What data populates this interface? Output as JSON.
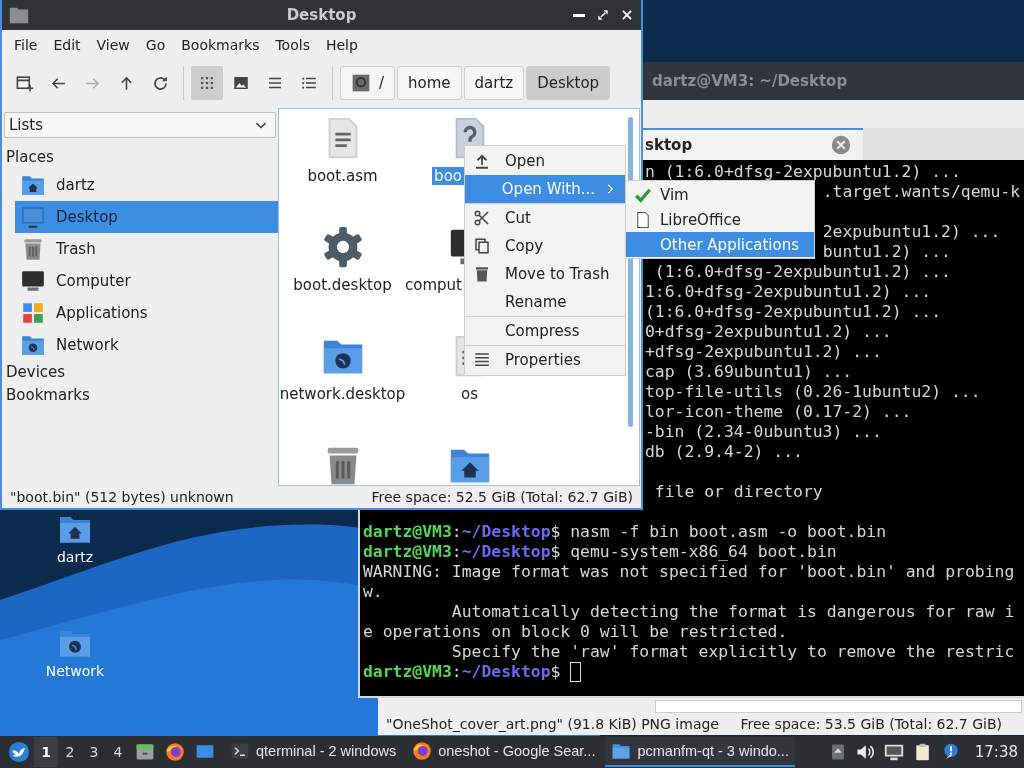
{
  "desktop_icons": [
    {
      "label": "dartz",
      "kind": "home"
    },
    {
      "label": "Network",
      "kind": "network"
    }
  ],
  "background_window": {
    "status_left": "\"OneShot_cover_art.png\" (91.8 KiB) PNG image",
    "status_right": "Free space: 53.5 GiB (Total: 62.7 GiB)"
  },
  "terminal": {
    "title": "dartz@VM3: ~/Desktop",
    "tab": {
      "label": "sktop",
      "selected": true
    },
    "upper_lines": [
      "n (1:6.0+dfsg-2expubuntu1.2) ...",
      ".target.wants/qemu-k",
      "2expubuntu1.2) ...",
      "buntu1.2) ...",
      "(1:6.0+dfsg-2expubuntu1.2) ...",
      "1:6.0+dfsg-2expubuntu1.2) ...",
      "(1:6.0+dfsg-2expubuntu1.2) ...",
      "0+dfsg-2expubuntu1.2) ...",
      "+dfsg-2expubuntu1.2) ...",
      "cap (3.69ubuntu1) ...",
      "top-file-utils (0.26-1ubuntu2) ...",
      "lor-icon-theme (0.17-2) ...",
      "-bin (2.34-0ubuntu3) ...",
      "db (2.9.4-2) ...",
      "file or directory"
    ],
    "lines": [
      {
        "kind": "prompt",
        "user": "dartz@VM3",
        "sep": ":",
        "path": "~/Desktop",
        "command": "$ nasm -f bin boot.asm -o boot.bin",
        "cursor": false
      },
      {
        "kind": "prompt",
        "user": "dartz@VM3",
        "sep": ":",
        "path": "~/Desktop",
        "command": "$ qemu-system-x86_64 boot.bin",
        "cursor": false
      },
      {
        "kind": "output",
        "text": "WARNING: Image format was not specified for 'boot.bin' and probing"
      },
      {
        "kind": "output",
        "text": "w."
      },
      {
        "kind": "output",
        "text": "         Automatically detecting the format is dangerous for raw i"
      },
      {
        "kind": "output",
        "text": "e operations on block 0 will be restricted."
      },
      {
        "kind": "output",
        "text": "         Specify the 'raw' format explicitly to remove the restric"
      },
      {
        "kind": "prompt",
        "user": "dartz@VM3",
        "sep": ":",
        "path": "~/Desktop",
        "command": "$",
        "cursor": true
      }
    ]
  },
  "file_manager": {
    "title": "Desktop",
    "menu": [
      "File",
      "Edit",
      "View",
      "Go",
      "Bookmarks",
      "Tools",
      "Help"
    ],
    "nav_buttons": [
      {
        "kind": "new-tab",
        "disabled": false
      },
      {
        "kind": "back",
        "disabled": false
      },
      {
        "kind": "forward",
        "disabled": true
      },
      {
        "kind": "up",
        "disabled": false
      },
      {
        "kind": "reload",
        "disabled": false
      }
    ],
    "view_buttons": [
      {
        "kind": "icons",
        "selected": true
      },
      {
        "kind": "thumbnails",
        "selected": false
      },
      {
        "kind": "compact",
        "selected": false
      },
      {
        "kind": "details",
        "selected": false
      }
    ],
    "path": [
      {
        "label": "/",
        "kind": "root",
        "selected": false
      },
      {
        "label": "home",
        "kind": "dir",
        "selected": false
      },
      {
        "label": "dartz",
        "kind": "dir",
        "selected": false
      },
      {
        "label": "Desktop",
        "kind": "dir",
        "selected": true
      }
    ],
    "side_view": "Lists",
    "sections": [
      {
        "label": "Places",
        "items": [
          {
            "label": "dartz",
            "kind": "home",
            "selected": false
          },
          {
            "label": "Desktop",
            "kind": "desktop",
            "selected": true
          },
          {
            "label": "Trash",
            "kind": "trash",
            "selected": false
          },
          {
            "label": "Computer",
            "kind": "computer",
            "selected": false
          },
          {
            "label": "Applications",
            "kind": "apps",
            "selected": false
          },
          {
            "label": "Network",
            "kind": "network",
            "selected": false
          }
        ]
      },
      {
        "label": "Devices"
      },
      {
        "label": "Bookmarks"
      }
    ],
    "files": [
      {
        "name": "boot.asm",
        "kind": "text",
        "selected": false
      },
      {
        "name": "boo",
        "kind": "unknown",
        "selected": true
      },
      {
        "name": "boot.desktop",
        "kind": "settings",
        "selected": false
      },
      {
        "name": "comput",
        "kind": "computer",
        "selected": false
      },
      {
        "name": "network.desktop",
        "kind": "network",
        "selected": false
      },
      {
        "name": "os",
        "kind": "text",
        "selected": false
      },
      {
        "kind": "trash"
      },
      {
        "kind": "home"
      }
    ],
    "status_left": "\"boot.bin\" (512 bytes) unknown",
    "status_right": "Free space: 52.5 GiB (Total: 62.7 GiB)"
  },
  "context_menu": {
    "items": [
      {
        "label": "Open",
        "kind": "open",
        "selected": false
      },
      {
        "label": "Open With...",
        "kind": "submenu",
        "selected": true
      },
      {
        "kind": "separator"
      },
      {
        "label": "Cut",
        "kind": "cut",
        "selected": false
      },
      {
        "label": "Copy",
        "kind": "copy",
        "selected": false
      },
      {
        "label": "Move to Trash",
        "kind": "trash",
        "selected": false
      },
      {
        "label": "Rename",
        "kind": "plain",
        "selected": false
      },
      {
        "kind": "separator"
      },
      {
        "label": "Compress",
        "kind": "plain",
        "selected": false
      },
      {
        "kind": "separator"
      },
      {
        "label": "Properties",
        "kind": "properties",
        "selected": false
      }
    ],
    "submenu": [
      {
        "label": "Vim",
        "kind": "vim",
        "selected": false
      },
      {
        "label": "LibreOffice",
        "kind": "document",
        "selected": false
      },
      {
        "label": "Other Applications",
        "kind": "plain",
        "selected": true
      }
    ]
  },
  "taskbar": {
    "desktops": [
      {
        "label": "1",
        "selected": true
      },
      {
        "label": "2",
        "selected": false
      },
      {
        "label": "3",
        "selected": false
      },
      {
        "label": "4",
        "selected": false
      }
    ],
    "tasks": [
      {
        "label": "qterminal - 2 windows",
        "kind": "terminal",
        "selected": false
      },
      {
        "label": "oneshot - Google Sear...",
        "kind": "browser",
        "selected": false
      },
      {
        "label": "pcmanfm-qt - 3 windo...",
        "kind": "folder",
        "selected": true
      }
    ],
    "clock": "17:38"
  }
}
